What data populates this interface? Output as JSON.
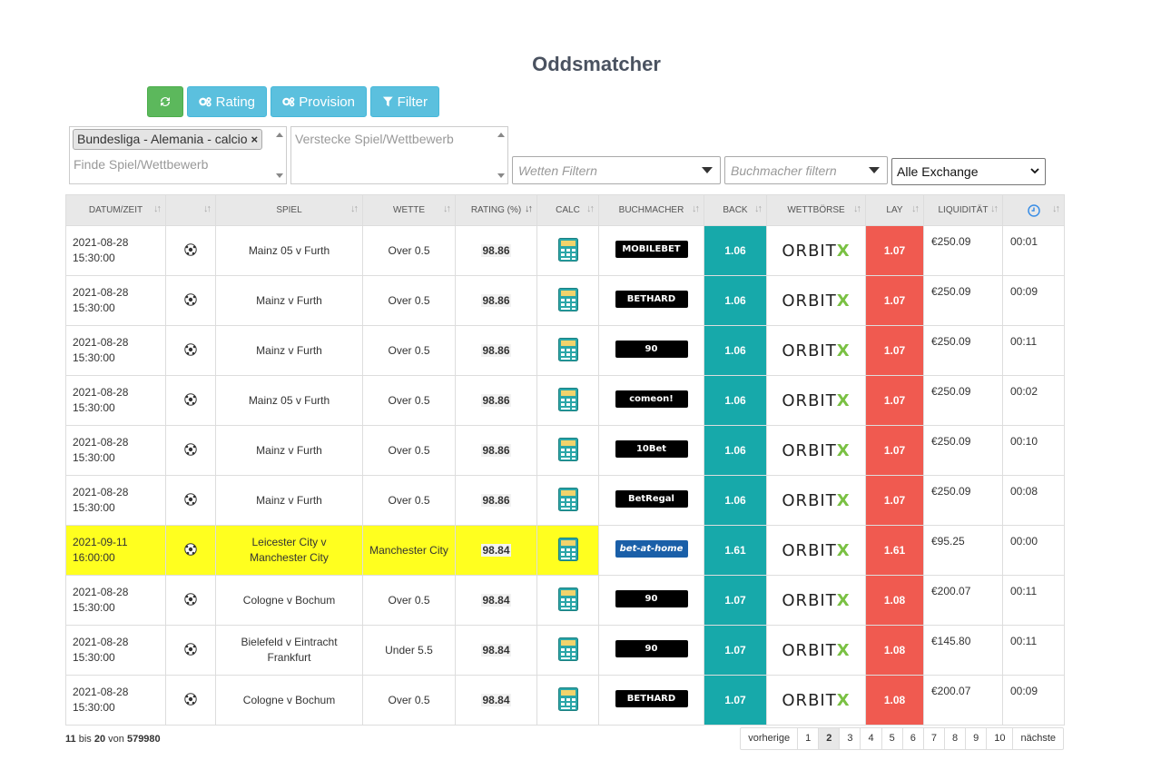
{
  "title": "Oddsmatcher",
  "buttons": {
    "rating": "Rating",
    "provision": "Provision",
    "filter": "Filter"
  },
  "filters": {
    "tag": "Bundesliga - Alemania - calcio",
    "find_placeholder": "Finde Spiel/Wettbewerb",
    "hide_placeholder": "Verstecke Spiel/Wettbewerb",
    "wetten_placeholder": "Wetten Filtern",
    "buchmacher_placeholder": "Buchmacher filtern",
    "exchange_selected": "Alle Exchange"
  },
  "headers": [
    "DATUM/ZEIT",
    "",
    "SPIEL",
    "WETTE",
    "RATING (%)",
    "CALC",
    "BUCHMACHER",
    "BACK",
    "WETTBÖRSE",
    "LAY",
    "LIQUIDITÄT",
    ""
  ],
  "exchange_name": {
    "a": "ORBIT",
    "b": "X"
  },
  "rows": [
    {
      "date": "2021-08-28",
      "time": "15:30:00",
      "game": "Mainz 05 v Furth",
      "bet": "Over 0.5",
      "rating": "98.86",
      "bookmaker": "MOBILEBET",
      "back": "1.06",
      "lay": "1.07",
      "liq": "€250.09",
      "clock": "00:01"
    },
    {
      "date": "2021-08-28",
      "time": "15:30:00",
      "game": "Mainz v Furth",
      "bet": "Over 0.5",
      "rating": "98.86",
      "bookmaker": "BETHARD",
      "back": "1.06",
      "lay": "1.07",
      "liq": "€250.09",
      "clock": "00:09"
    },
    {
      "date": "2021-08-28",
      "time": "15:30:00",
      "game": "Mainz v Furth",
      "bet": "Over 0.5",
      "rating": "98.86",
      "bookmaker": "90",
      "back": "1.06",
      "lay": "1.07",
      "liq": "€250.09",
      "clock": "00:11"
    },
    {
      "date": "2021-08-28",
      "time": "15:30:00",
      "game": "Mainz 05 v Furth",
      "bet": "Over 0.5",
      "rating": "98.86",
      "bookmaker": "comeon!",
      "back": "1.06",
      "lay": "1.07",
      "liq": "€250.09",
      "clock": "00:02"
    },
    {
      "date": "2021-08-28",
      "time": "15:30:00",
      "game": "Mainz v Furth",
      "bet": "Over 0.5",
      "rating": "98.86",
      "bookmaker": "10Bet",
      "back": "1.06",
      "lay": "1.07",
      "liq": "€250.09",
      "clock": "00:10"
    },
    {
      "date": "2021-08-28",
      "time": "15:30:00",
      "game": "Mainz v Furth",
      "bet": "Over 0.5",
      "rating": "98.86",
      "bookmaker": "BetRegal",
      "back": "1.06",
      "lay": "1.07",
      "liq": "€250.09",
      "clock": "00:08"
    },
    {
      "date": "2021-09-11",
      "time": "16:00:00",
      "game": "Leicester City v Manchester City",
      "bet": "Manchester City",
      "rating": "98.84",
      "bookmaker": "bet-at-home",
      "back": "1.61",
      "lay": "1.61",
      "liq": "€95.25",
      "clock": "00:00",
      "highlight": true
    },
    {
      "date": "2021-08-28",
      "time": "15:30:00",
      "game": "Cologne v Bochum",
      "bet": "Over 0.5",
      "rating": "98.84",
      "bookmaker": "90",
      "back": "1.07",
      "lay": "1.08",
      "liq": "€200.07",
      "clock": "00:11"
    },
    {
      "date": "2021-08-28",
      "time": "15:30:00",
      "game": "Bielefeld v Eintracht Frankfurt",
      "bet": "Under 5.5",
      "rating": "98.84",
      "bookmaker": "90",
      "back": "1.07",
      "lay": "1.08",
      "liq": "€145.80",
      "clock": "00:11"
    },
    {
      "date": "2021-08-28",
      "time": "15:30:00",
      "game": "Cologne v Bochum",
      "bet": "Over 0.5",
      "rating": "98.84",
      "bookmaker": "BETHARD",
      "back": "1.07",
      "lay": "1.08",
      "liq": "€200.07",
      "clock": "00:09"
    }
  ],
  "footer": {
    "from": "11",
    "bis": "bis",
    "to": "20",
    "von": "von",
    "total": "579980"
  },
  "pagination": [
    "vorherige",
    "1",
    "2",
    "3",
    "4",
    "5",
    "6",
    "7",
    "8",
    "9",
    "10",
    "nächste"
  ],
  "active_page": "2",
  "colors": {
    "back": "#17a9aa",
    "lay": "#f05a50",
    "highlight": "#ffff1f",
    "green_button": "#5cb85c",
    "blue_button": "#5bc0de"
  }
}
